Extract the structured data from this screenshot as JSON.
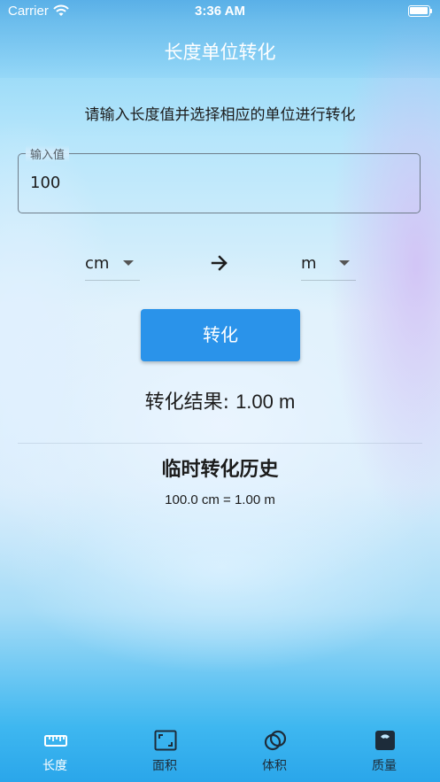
{
  "status_bar": {
    "carrier": "Carrier",
    "time": "3:36 AM"
  },
  "app_bar": {
    "title": "长度单位转化"
  },
  "main": {
    "instruction": "请输入长度值并选择相应的单位进行转化",
    "input": {
      "label": "输入值",
      "value": "100"
    },
    "from_unit": "cm",
    "to_unit": "m",
    "convert_label": "转化",
    "result_label": "转化结果: ",
    "result_value": "1.00 m",
    "history_title": "临时转化历史",
    "history": [
      "100.0 cm = 1.00 m"
    ]
  },
  "nav": {
    "items": [
      {
        "label": "长度",
        "icon": "ruler-icon",
        "active": true
      },
      {
        "label": "面积",
        "icon": "area-icon",
        "active": false
      },
      {
        "label": "体积",
        "icon": "volume-icon",
        "active": false
      },
      {
        "label": "质量",
        "icon": "scale-icon",
        "active": false
      }
    ]
  },
  "colors": {
    "accent": "#2a93ea",
    "active_nav": "#ffffff",
    "inactive_nav": "#1d2c3a"
  }
}
